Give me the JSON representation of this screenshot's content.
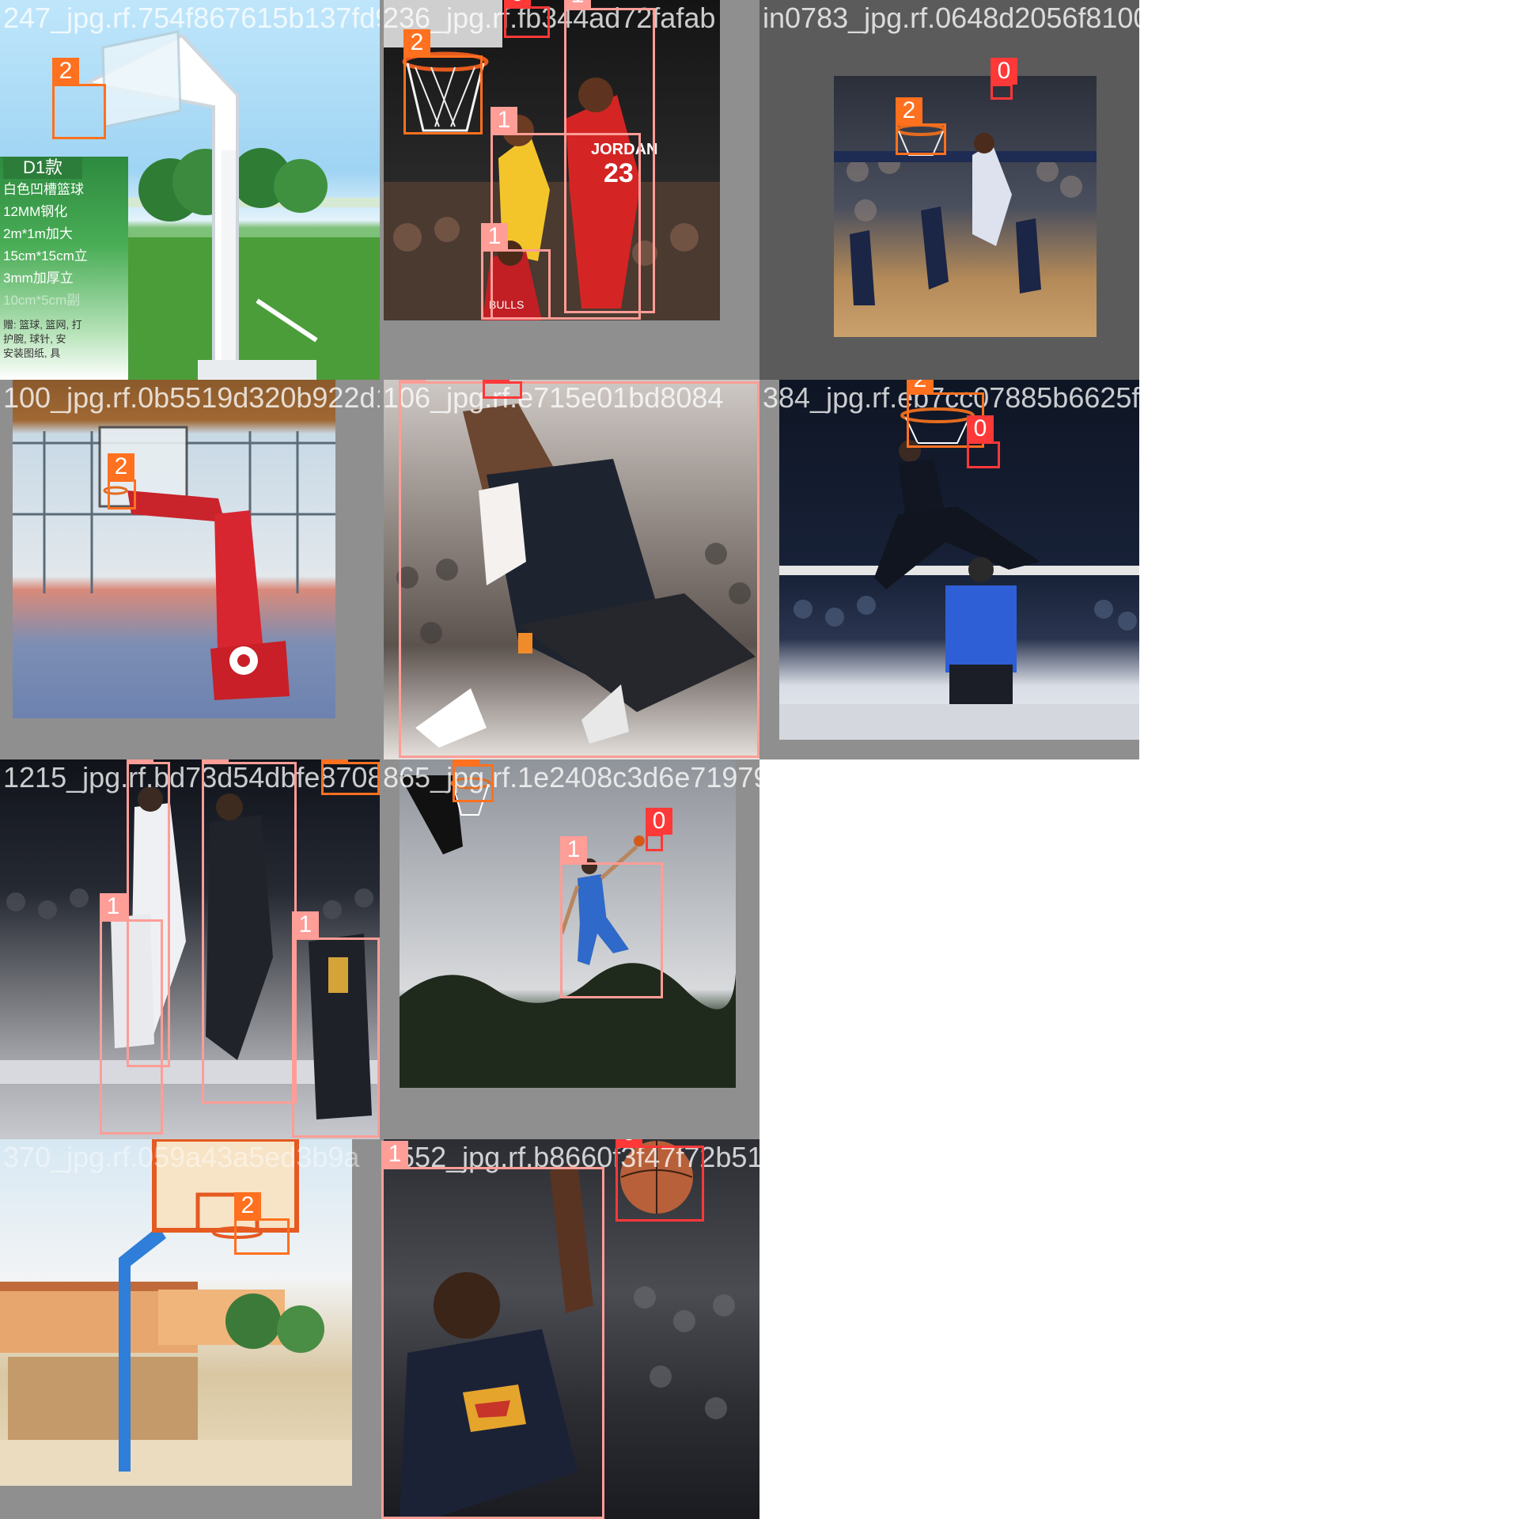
{
  "class_colors": {
    "0": "#ff3838",
    "1": "#ff9d97",
    "2": "#ff701f"
  },
  "tiles": [
    {
      "filename": "247_jpg.rf.754f867615b137fd936d",
      "labels": [
        "2"
      ],
      "sign_text": [
        "D1款",
        "白色凹槽篮球",
        "12MM钢化",
        "2m*1m加大",
        "15cm*15cm立",
        "3mm加厚立",
        "10cm*5cm副",
        "赠: 篮球, 篮网, 打",
        "护腕, 球针, 安",
        "安装图纸, 具"
      ]
    },
    {
      "filename": "236_jpg.rf.fb344ad72fafab",
      "labels": [
        "0",
        "1",
        "2",
        "1",
        "1"
      ],
      "jersey_text": [
        "JORDAN",
        "23",
        "BULLS"
      ]
    },
    {
      "filename": "in0783_jpg.rf.0648d2056f8100a0f399615bff1",
      "labels": [
        "0",
        "2"
      ]
    },
    {
      "filename": "100_jpg.rf.0b5519d320b922d1f06bf5188547c",
      "labels": [
        "2"
      ]
    },
    {
      "filename": "106_jpg.rf.e715e01bd8084",
      "labels": [
        "1",
        "0"
      ]
    },
    {
      "filename": "384_jpg.rf.eb7cc07885b6625f71392656da",
      "labels": [
        "2",
        "0"
      ]
    },
    {
      "filename": "1215_jpg.rf.bd73d54dbfe8708656",
      "labels": [
        "1",
        "1",
        "2",
        "1",
        "1"
      ]
    },
    {
      "filename": "865_jpg.rf.1e2408c3d6e719795f199cbb520bb",
      "labels": [
        "2",
        "1",
        "0"
      ]
    },
    {
      "filename": "370_jpg.rf.059a43a5ed3b9a",
      "labels": [
        "2"
      ]
    },
    {
      "filename": "1552_jpg.rf.b8660f3f47f72b51d73f2000f41bd",
      "labels": [
        "1",
        "0"
      ]
    }
  ]
}
